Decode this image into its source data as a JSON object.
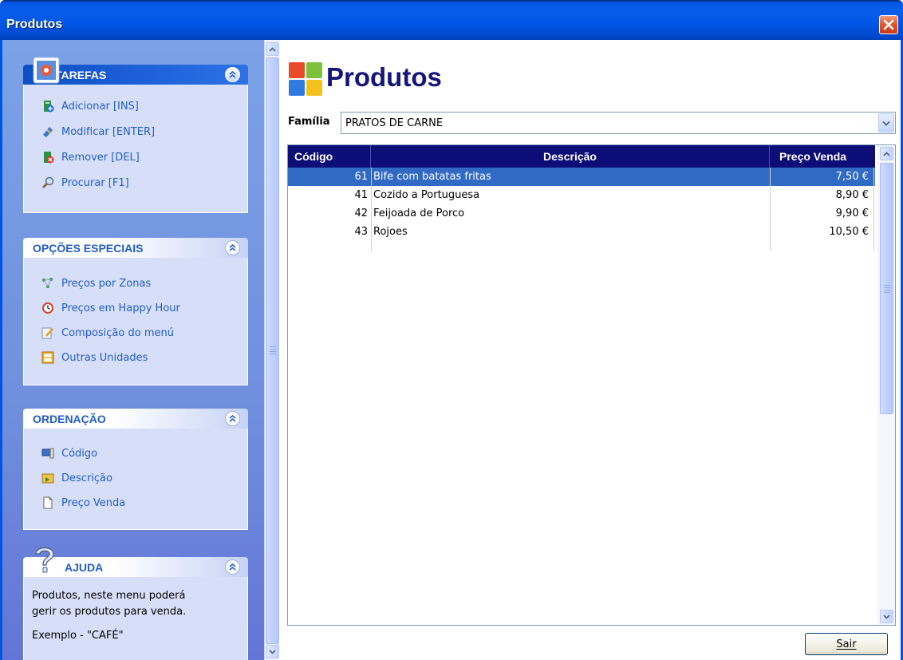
{
  "window": {
    "title": "Produtos"
  },
  "taskpane": {
    "tarefas": {
      "title": "TAREFAS",
      "items": [
        {
          "label": "Adicionar [INS]",
          "icon": "add-icon"
        },
        {
          "label": "Modificar [ENTER]",
          "icon": "edit-icon"
        },
        {
          "label": "Remover [DEL]",
          "icon": "remove-icon"
        },
        {
          "label": "Procurar [F1]",
          "icon": "search-icon"
        }
      ]
    },
    "opcoes": {
      "title": "OPÇÕES ESPECIAIS",
      "items": [
        {
          "label": "Preços por Zonas",
          "icon": "zones-icon"
        },
        {
          "label": "Preços em Happy Hour",
          "icon": "clock-icon"
        },
        {
          "label": "Composição do menú",
          "icon": "menu-composition-icon"
        },
        {
          "label": "Outras Unidades",
          "icon": "units-icon"
        }
      ]
    },
    "ordenacao": {
      "title": "ORDENAÇÃO",
      "items": [
        {
          "label": "Código",
          "icon": "code-sort-icon"
        },
        {
          "label": "Descrição",
          "icon": "description-sort-icon"
        },
        {
          "label": "Preço Venda",
          "icon": "price-sort-icon"
        }
      ]
    },
    "ajuda": {
      "title": "AJUDA",
      "line1": "Produtos, neste menu poderá",
      "line2": "gerir os produtos para venda.",
      "example": "Exemplo - \"CAFÉ\""
    }
  },
  "main": {
    "page_title": "Produtos",
    "familia_label": "Família",
    "familia_value": "PRATOS DE CARNE",
    "columns": [
      "Código",
      "Descrição",
      "Preço Venda"
    ],
    "rows": [
      {
        "codigo": "61",
        "descricao": "Bife com batatas fritas",
        "preco": "7,50 €",
        "selected": true
      },
      {
        "codigo": "41",
        "descricao": "Cozido a Portuguesa",
        "preco": "8,90 €",
        "selected": false
      },
      {
        "codigo": "42",
        "descricao": "Feijoada de Porco",
        "preco": "9,90 €",
        "selected": false
      },
      {
        "codigo": "43",
        "descricao": "Rojoes",
        "preco": "10,50 €",
        "selected": false
      }
    ],
    "exit_label": "Sair"
  },
  "colors": {
    "title_blue": "#0054e3",
    "task_link": "#215dc6",
    "grid_header": "#0d0d78",
    "selection": "#316ac5",
    "page_title": "#15157a"
  }
}
